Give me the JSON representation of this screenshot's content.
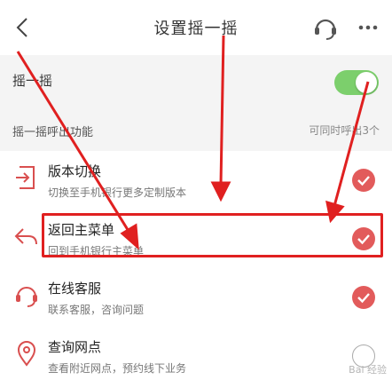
{
  "header": {
    "title": "设置摇一摇"
  },
  "shake": {
    "label": "摇一摇",
    "enabled": true
  },
  "section": {
    "title": "摇一摇呼出功能",
    "note": "可同时呼出3个"
  },
  "items": [
    {
      "title": "版本切换",
      "subtitle": "切换至手机银行更多定制版本",
      "checked": true,
      "icon": "switch-icon"
    },
    {
      "title": "返回主菜单",
      "subtitle": "回到手机银行主菜单",
      "checked": true,
      "icon": "return-icon"
    },
    {
      "title": "在线客服",
      "subtitle": "联系客服，咨询问题",
      "checked": true,
      "icon": "headset-icon"
    },
    {
      "title": "查询网点",
      "subtitle": "查看附近网点，预约线下业务",
      "checked": false,
      "icon": "location-icon"
    }
  ],
  "watermark": "Bai 经验",
  "colors": {
    "accent": "#e25b5b",
    "toggle_on": "#7ccf6c",
    "annotation": "#e02020"
  }
}
